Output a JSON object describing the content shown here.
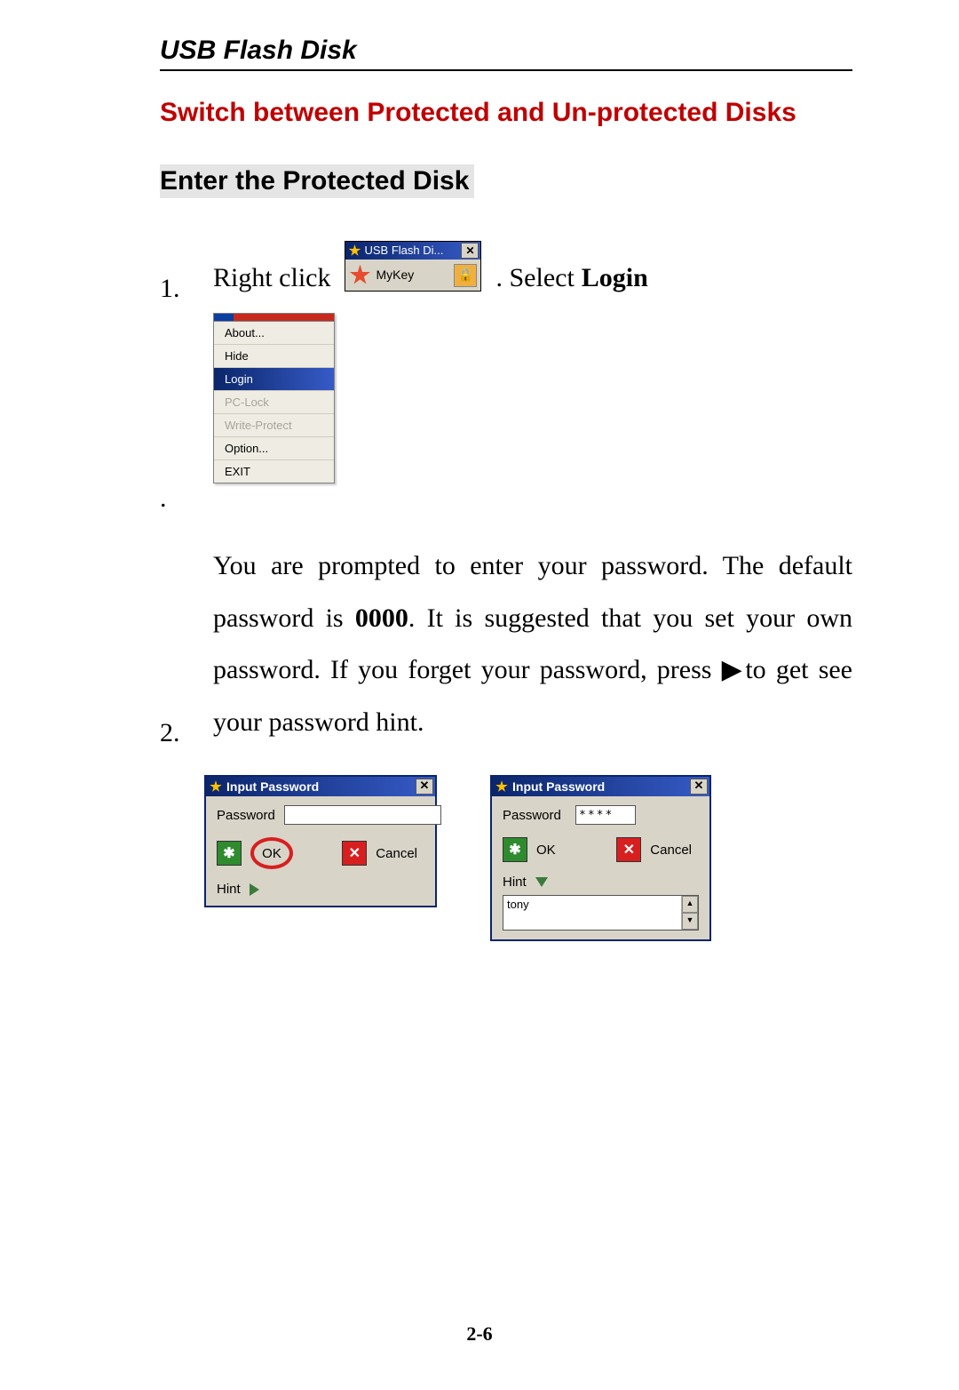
{
  "header": {
    "title": "USB Flash Disk"
  },
  "section": {
    "title": "Switch between Protected and Un-protected Disks"
  },
  "subsection": {
    "title": "Enter the Protected Disk"
  },
  "step1": {
    "num": "1.",
    "pre": "Right  click",
    "post": ".   Select",
    "bold": "Login"
  },
  "mykey": {
    "titlebar": "USB Flash Di...",
    "label": "MyKey"
  },
  "context_menu": {
    "items": [
      {
        "label": "About...",
        "state": "normal"
      },
      {
        "label": "Hide",
        "state": "normal"
      },
      {
        "label": "Login",
        "state": "selected"
      },
      {
        "label": "PC-Lock",
        "state": "disabled"
      },
      {
        "label": "Write-Protect",
        "state": "disabled"
      },
      {
        "label": "Option...",
        "state": "normal"
      },
      {
        "label": "EXIT",
        "state": "normal"
      }
    ]
  },
  "step2": {
    "num": "2.",
    "line1a": "You are prompted to enter your password. The default password is ",
    "line1_bold": "0000",
    "line1b": ". It is  suggested that you set your own password.    If     you forget your password, press ▶to get        see your password hint."
  },
  "pw_dialog": {
    "title": "Input Password",
    "password_label": "Password",
    "ok_label": "OK",
    "cancel_label": "Cancel",
    "hint_label": "Hint",
    "pw_value": "****",
    "hint_value": "tony"
  },
  "page_number": "2-6"
}
